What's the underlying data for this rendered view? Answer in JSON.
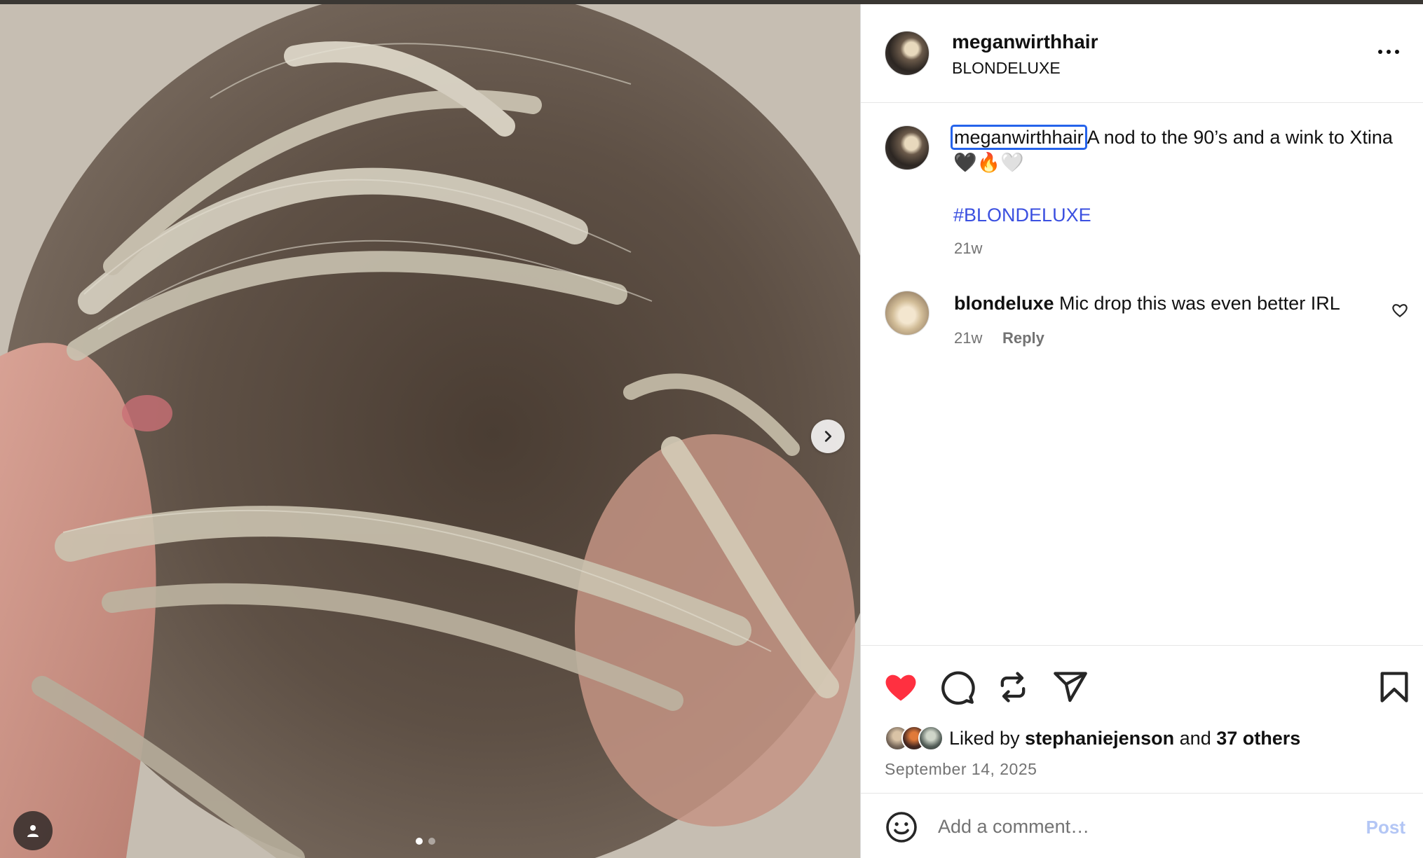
{
  "post": {
    "username": "meganwirthhair",
    "subtitle": "BLONDELUXE",
    "caption_user": "meganwirthhair",
    "caption_text": "A nod to the 90’s and a wink to Xtina🖤🔥🤍",
    "hashtag": "#BLONDELUXE",
    "caption_time": "21w"
  },
  "comment": {
    "username": "blondeluxe",
    "text": "Mic drop this was even better IRL",
    "time": "21w",
    "reply_label": "Reply"
  },
  "likes": {
    "prefix": "Liked by",
    "user": "stephaniejenson",
    "connector": "and",
    "others": "37 others",
    "date": "September 14, 2025",
    "liked": true
  },
  "composer": {
    "placeholder": "Add a comment…",
    "post_label": "Post"
  },
  "carousel": {
    "current": 1,
    "total": 2
  },
  "colors": {
    "like_red": "#ff3040",
    "link_blue": "#3b50e0",
    "post_disabled": "#b3c6f5",
    "focus_outline": "#2563eb"
  },
  "icons": [
    "more-horizontal-icon",
    "heart-icon",
    "comment-icon",
    "repost-icon",
    "share-icon",
    "bookmark-icon",
    "emoji-icon",
    "chevron-right-icon",
    "user-tag-icon"
  ]
}
